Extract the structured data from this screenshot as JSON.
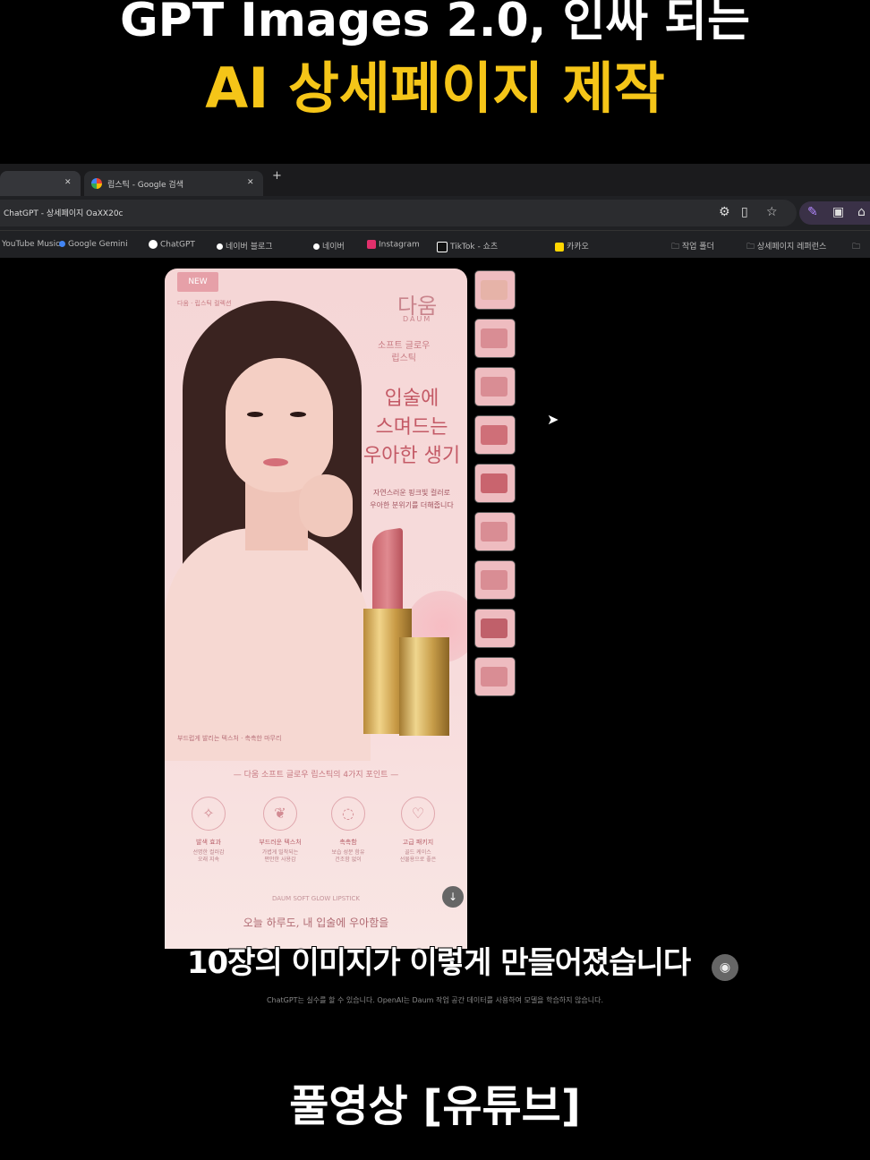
{
  "caption": {
    "line1": "GPT Images 2.0, 인싸 되는",
    "line2": "AI 상세페이지 제작"
  },
  "browser": {
    "tabs": [
      {
        "label": ""
      },
      {
        "label": "립스틱 - Google 검색"
      }
    ],
    "address": "ChatGPT - 상세페이지 OaXX20c",
    "bookmarks": [
      {
        "label": "YouTube Music",
        "color": "#e53935"
      },
      {
        "label": "Google Gemini",
        "color": "#4285f4"
      },
      {
        "label": "ChatGPT",
        "color": "#ffffff"
      },
      {
        "label": "네이버 블로그",
        "color": "#ffffff"
      },
      {
        "label": "네이버",
        "color": "#ffffff"
      },
      {
        "label": "Instagram",
        "color": "#e1306c"
      },
      {
        "label": "TikTok - 쇼츠",
        "color": "#ffffff"
      },
      {
        "label": "카카오",
        "color": "#ffd600"
      },
      {
        "label": "작업 폴더",
        "color": "#888888"
      },
      {
        "label": "상세페이지 레퍼런스",
        "color": "#888888"
      }
    ]
  },
  "product_page": {
    "badge": "NEW",
    "brand": "다움",
    "brand_sub": "DAUM",
    "product_name": "소프트 글로우\n립스틱",
    "headline": "입술에\n스며드는\n우아한 생기",
    "subcopy": "자연스러운 핑크빛 컬러로\n우아한 분위기를 더해줍니다",
    "corner_note": "다움 · 립스틱 컬렉션",
    "caption": "부드럽게 발리는 텍스처 · 촉촉한 마무리",
    "section_title": "다움 소프트 글로우 립스틱의 4가지 포인트",
    "features": [
      {
        "icon": "✧",
        "title": "발색 효과",
        "desc": "선명한 컬러감\n오래 지속"
      },
      {
        "icon": "❦",
        "title": "부드러운 텍스처",
        "desc": "가볍게 밀착되는\n편안한 사용감"
      },
      {
        "icon": "◌",
        "title": "촉촉함",
        "desc": "보습 성분 함유\n건조함 없이"
      },
      {
        "icon": "♡",
        "title": "고급 패키지",
        "desc": "골드 케이스\n선물용으로 좋은"
      }
    ],
    "footnote": "DAUM SOFT GLOW LIPSTICK",
    "bottom_line": "오늘 하루도, 내 입술에 우아함을"
  },
  "subtitle": "10장의 이미지가 이렇게 만들어졌습니다",
  "disclaimer": "ChatGPT는 실수를 할 수 있습니다. OpenAI는 Daum 작업 공간 데이터를 사용하여 모델을 학습하지 않습니다.",
  "footer": "풀영상 [유튜브]",
  "icons": {
    "scroll_down": "↓",
    "subtitle_badge": "◉"
  }
}
